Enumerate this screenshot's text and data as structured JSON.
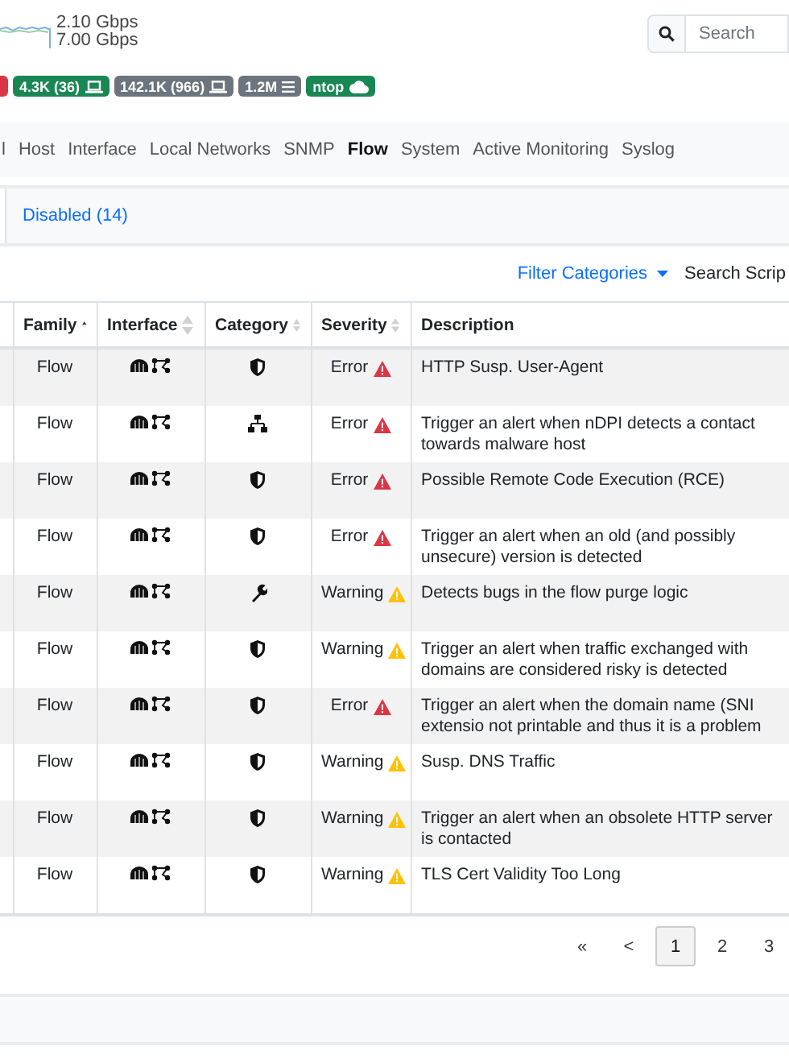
{
  "throughput": {
    "upload": "2.10 Gbps",
    "download": "7.00 Gbps"
  },
  "search": {
    "placeholder": "Search"
  },
  "badges": [
    {
      "kind": "alert",
      "color": "#dc3545"
    },
    {
      "text": "4.3K (36)",
      "kind": "hosts",
      "color": "#198754"
    },
    {
      "text": "142.1K (966)",
      "kind": "hosts",
      "color": "#6c757d"
    },
    {
      "text": "1.2M",
      "kind": "flows",
      "color": "#6c757d"
    },
    {
      "text": "ntop",
      "kind": "cloud",
      "color": "#198754"
    }
  ],
  "nav": [
    {
      "label": "l",
      "selected": false
    },
    {
      "label": "Host",
      "selected": false
    },
    {
      "label": "Interface",
      "selected": false
    },
    {
      "label": "Local Networks",
      "selected": false
    },
    {
      "label": "SNMP",
      "selected": false
    },
    {
      "label": "Flow",
      "selected": true
    },
    {
      "label": "System",
      "selected": false
    },
    {
      "label": "Active Monitoring",
      "selected": false
    },
    {
      "label": "Syslog",
      "selected": false
    }
  ],
  "tabs": [
    {
      "label": "Disabled (14)",
      "selected": false
    }
  ],
  "filter": {
    "label": "Filter Categories",
    "search_label": "Search Scrip"
  },
  "table": {
    "columns": [
      {
        "label": "Family",
        "sortable": true,
        "sorted": true
      },
      {
        "label": "Interface",
        "sortable": true,
        "sorted": false
      },
      {
        "label": "Category",
        "sortable": true,
        "sorted": false
      },
      {
        "label": "Severity",
        "sortable": true,
        "sorted": false
      },
      {
        "label": "Description"
      }
    ],
    "rows": [
      {
        "family": "Flow",
        "category": {
          "kind": "shield"
        },
        "severity": {
          "label": "Error",
          "kind": "error"
        },
        "description": "HTTP Susp. User-Agent"
      },
      {
        "family": "Flow",
        "category": {
          "kind": "network"
        },
        "severity": {
          "label": "Error",
          "kind": "error"
        },
        "description": "Trigger an alert when nDPI detects a contact towards malware host"
      },
      {
        "family": "Flow",
        "category": {
          "kind": "shield"
        },
        "severity": {
          "label": "Error",
          "kind": "error"
        },
        "description": "Possible Remote Code Execution (RCE)"
      },
      {
        "family": "Flow",
        "category": {
          "kind": "shield"
        },
        "severity": {
          "label": "Error",
          "kind": "error"
        },
        "description": "Trigger an alert when an old (and possibly unsecure) version is detected"
      },
      {
        "family": "Flow",
        "category": {
          "kind": "wrench"
        },
        "severity": {
          "label": "Warning",
          "kind": "warning"
        },
        "description": "Detects bugs in the flow purge logic"
      },
      {
        "family": "Flow",
        "category": {
          "kind": "shield"
        },
        "severity": {
          "label": "Warning",
          "kind": "warning"
        },
        "description": "Trigger an alert when traffic exchanged with domains are considered risky is detected"
      },
      {
        "family": "Flow",
        "category": {
          "kind": "shield"
        },
        "severity": {
          "label": "Error",
          "kind": "error"
        },
        "description": "Trigger an alert when the domain name (SNI extensio not printable and thus it is a problem"
      },
      {
        "family": "Flow",
        "category": {
          "kind": "shield"
        },
        "severity": {
          "label": "Warning",
          "kind": "warning"
        },
        "description": "Susp. DNS Traffic"
      },
      {
        "family": "Flow",
        "category": {
          "kind": "shield"
        },
        "severity": {
          "label": "Warning",
          "kind": "warning"
        },
        "description": "Trigger an alert when an obsolete HTTP server is contacted"
      },
      {
        "family": "Flow",
        "category": {
          "kind": "shield"
        },
        "severity": {
          "label": "Warning",
          "kind": "warning"
        },
        "description": "TLS Cert Validity Too Long"
      }
    ]
  },
  "pagination": [
    {
      "label": "«",
      "selected": false
    },
    {
      "label": "<",
      "selected": false
    },
    {
      "label": "1",
      "selected": true
    },
    {
      "label": "2",
      "selected": false
    },
    {
      "label": "3",
      "selected": false
    }
  ]
}
